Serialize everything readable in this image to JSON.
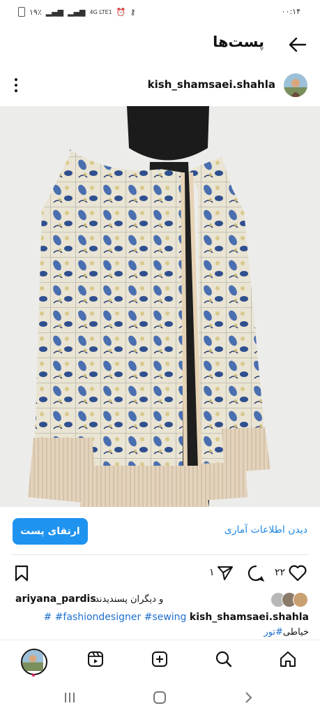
{
  "status_bar": {
    "battery": "۱۹٪",
    "network": "4G LTE1",
    "time": "۰۰:۱۴"
  },
  "header": {
    "title": "پست‌ها"
  },
  "post": {
    "username": "kish_shamsaei.shahla",
    "boost_label": "ارتقای پست",
    "insights_label": "دیدن اطلاعات آماری",
    "like_count": "۲۲",
    "share_count": "۱",
    "liked_by_user": "ariyana_pardis",
    "liked_by_text": "و دیگران پسندیدند",
    "caption_user": "kish_shamsaei.shahla",
    "caption_tags": [
      "#sewing",
      "#fashiondesigner",
      "#"
    ],
    "caption_line2_tags": [
      "#تور"
    ],
    "caption_line2_text": "خیاطی"
  },
  "icons": {
    "back": "arrow-left-icon",
    "more": "more-vertical-icon",
    "like": "heart-icon",
    "comment": "comment-icon",
    "share": "send-icon",
    "save": "bookmark-icon",
    "home": "home-icon",
    "search": "search-icon",
    "create": "plus-square-icon",
    "reels": "reels-icon"
  },
  "colors": {
    "accent": "#1e93f0",
    "link": "#1e88e5"
  }
}
